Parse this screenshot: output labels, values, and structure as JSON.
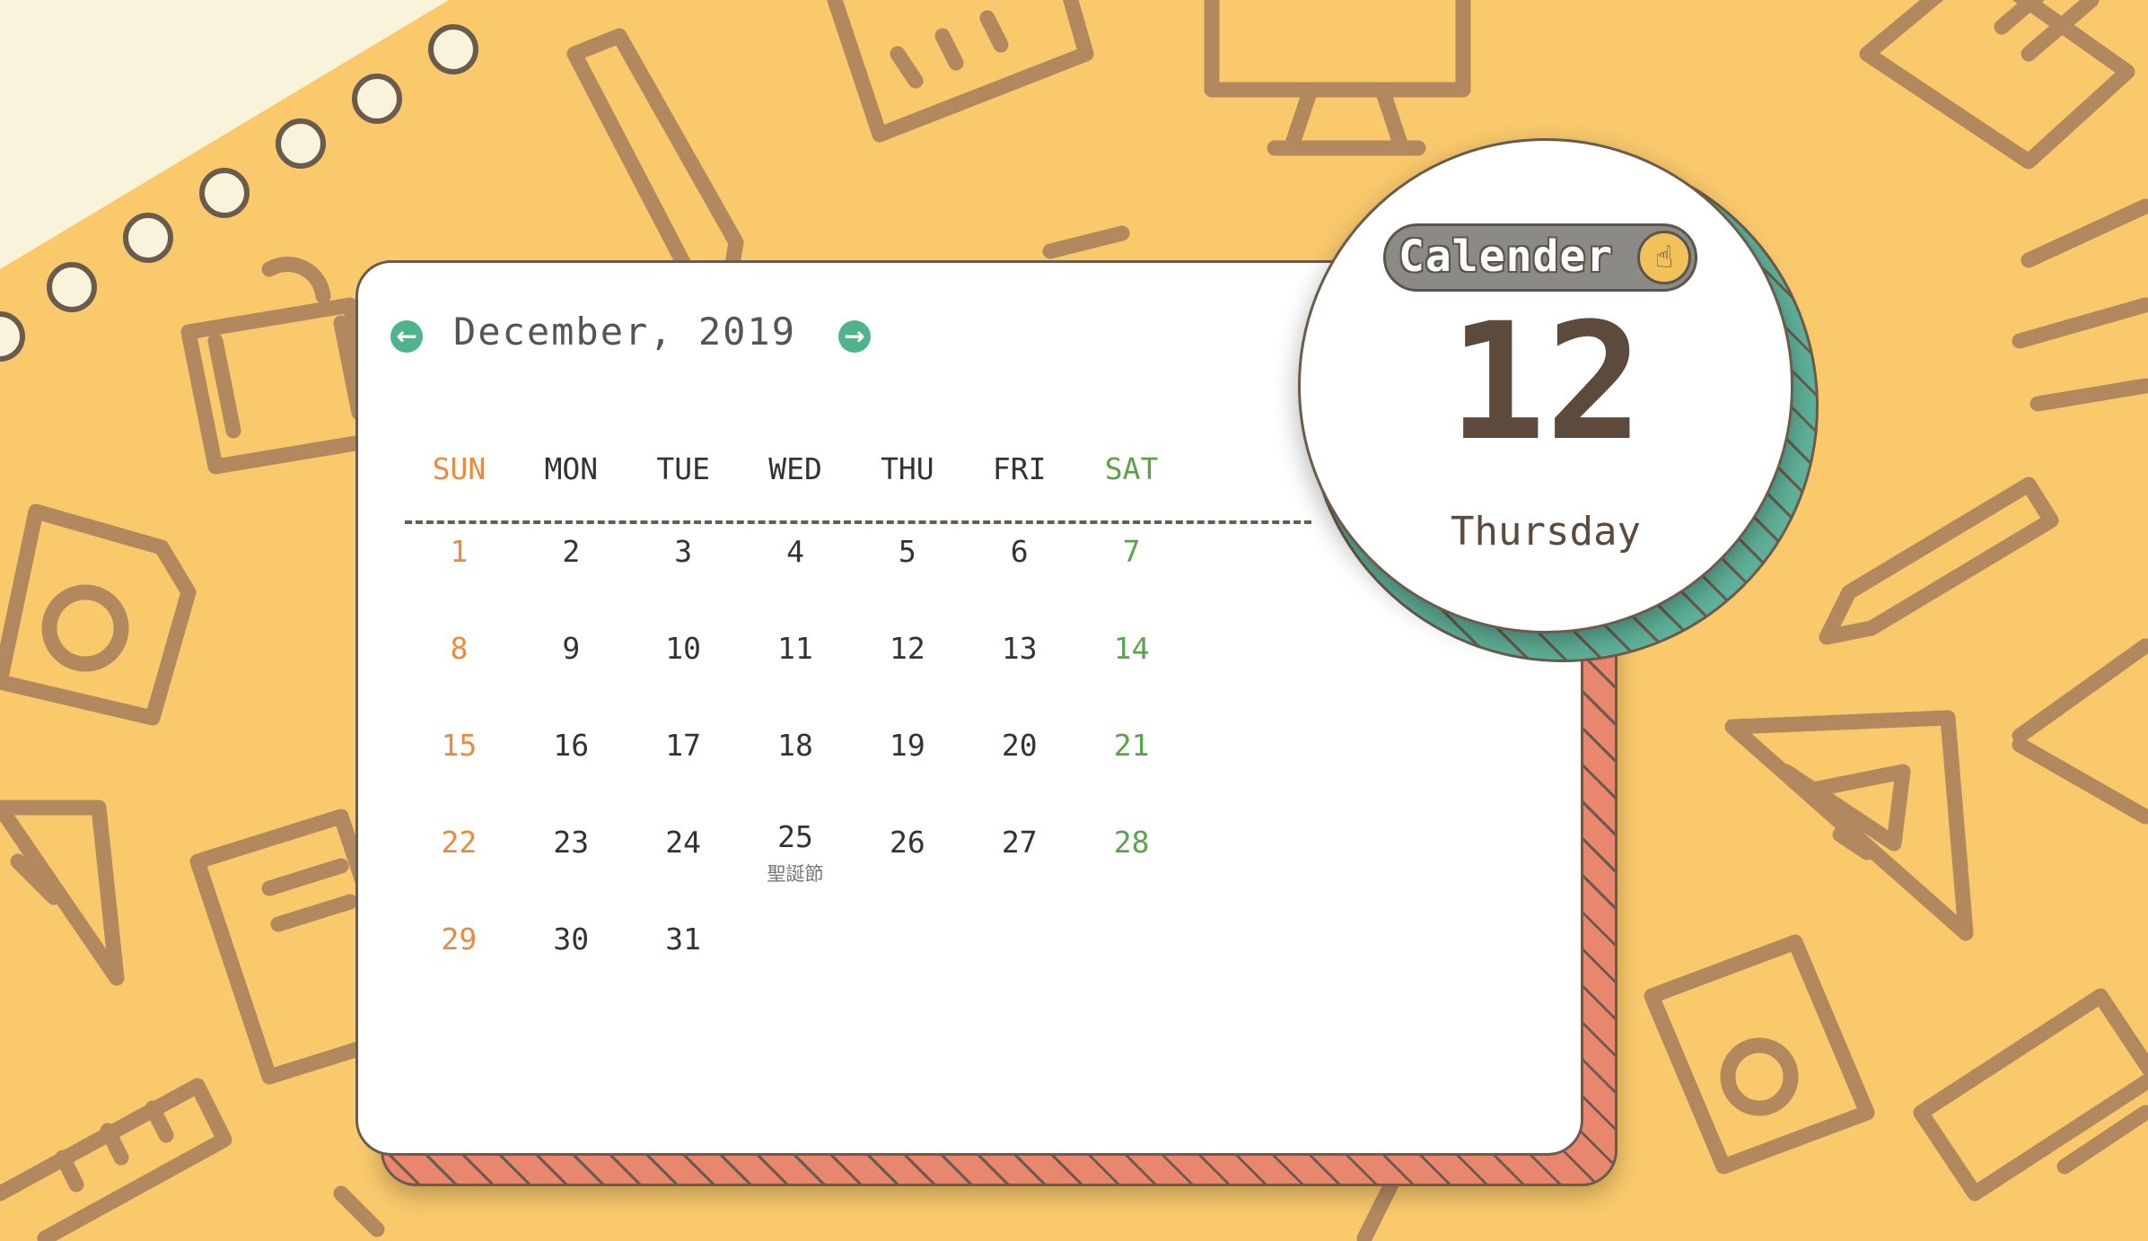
{
  "colors": {
    "background": "#f9c96c",
    "pattern": "#b2895f",
    "sunday": "#ea8a3c",
    "saturday": "#5aa34a",
    "accent_teal": "#4fb48b",
    "card_stripe": "#e8876d",
    "circle_stripe": "#5fb29a",
    "text_dark": "#5c4a3c"
  },
  "calendar": {
    "month_title": "December, 2019",
    "prev_icon": "arrow-left-icon",
    "next_icon": "arrow-right-icon",
    "weekdays": [
      "SUN",
      "MON",
      "TUE",
      "WED",
      "THU",
      "FRI",
      "SAT"
    ],
    "weeks": [
      [
        {
          "d": "1"
        },
        {
          "d": "2"
        },
        {
          "d": "3"
        },
        {
          "d": "4"
        },
        {
          "d": "5"
        },
        {
          "d": "6"
        },
        {
          "d": "7"
        }
      ],
      [
        {
          "d": "8"
        },
        {
          "d": "9"
        },
        {
          "d": "10"
        },
        {
          "d": "11"
        },
        {
          "d": "12"
        },
        {
          "d": "13"
        },
        {
          "d": "14"
        }
      ],
      [
        {
          "d": "15"
        },
        {
          "d": "16"
        },
        {
          "d": "17"
        },
        {
          "d": "18"
        },
        {
          "d": "19"
        },
        {
          "d": "20"
        },
        {
          "d": "21"
        }
      ],
      [
        {
          "d": "22"
        },
        {
          "d": "23"
        },
        {
          "d": "24"
        },
        {
          "d": "25",
          "note": "聖誕節"
        },
        {
          "d": "26"
        },
        {
          "d": "27"
        },
        {
          "d": "28"
        }
      ],
      [
        {
          "d": "29"
        },
        {
          "d": "30"
        },
        {
          "d": "31"
        },
        {
          "d": ""
        },
        {
          "d": ""
        },
        {
          "d": ""
        },
        {
          "d": ""
        }
      ]
    ]
  },
  "today": {
    "badge_label": "Calender",
    "badge_icon": "pointing-hand-icon",
    "date_number": "12",
    "weekday": "Thursday"
  }
}
